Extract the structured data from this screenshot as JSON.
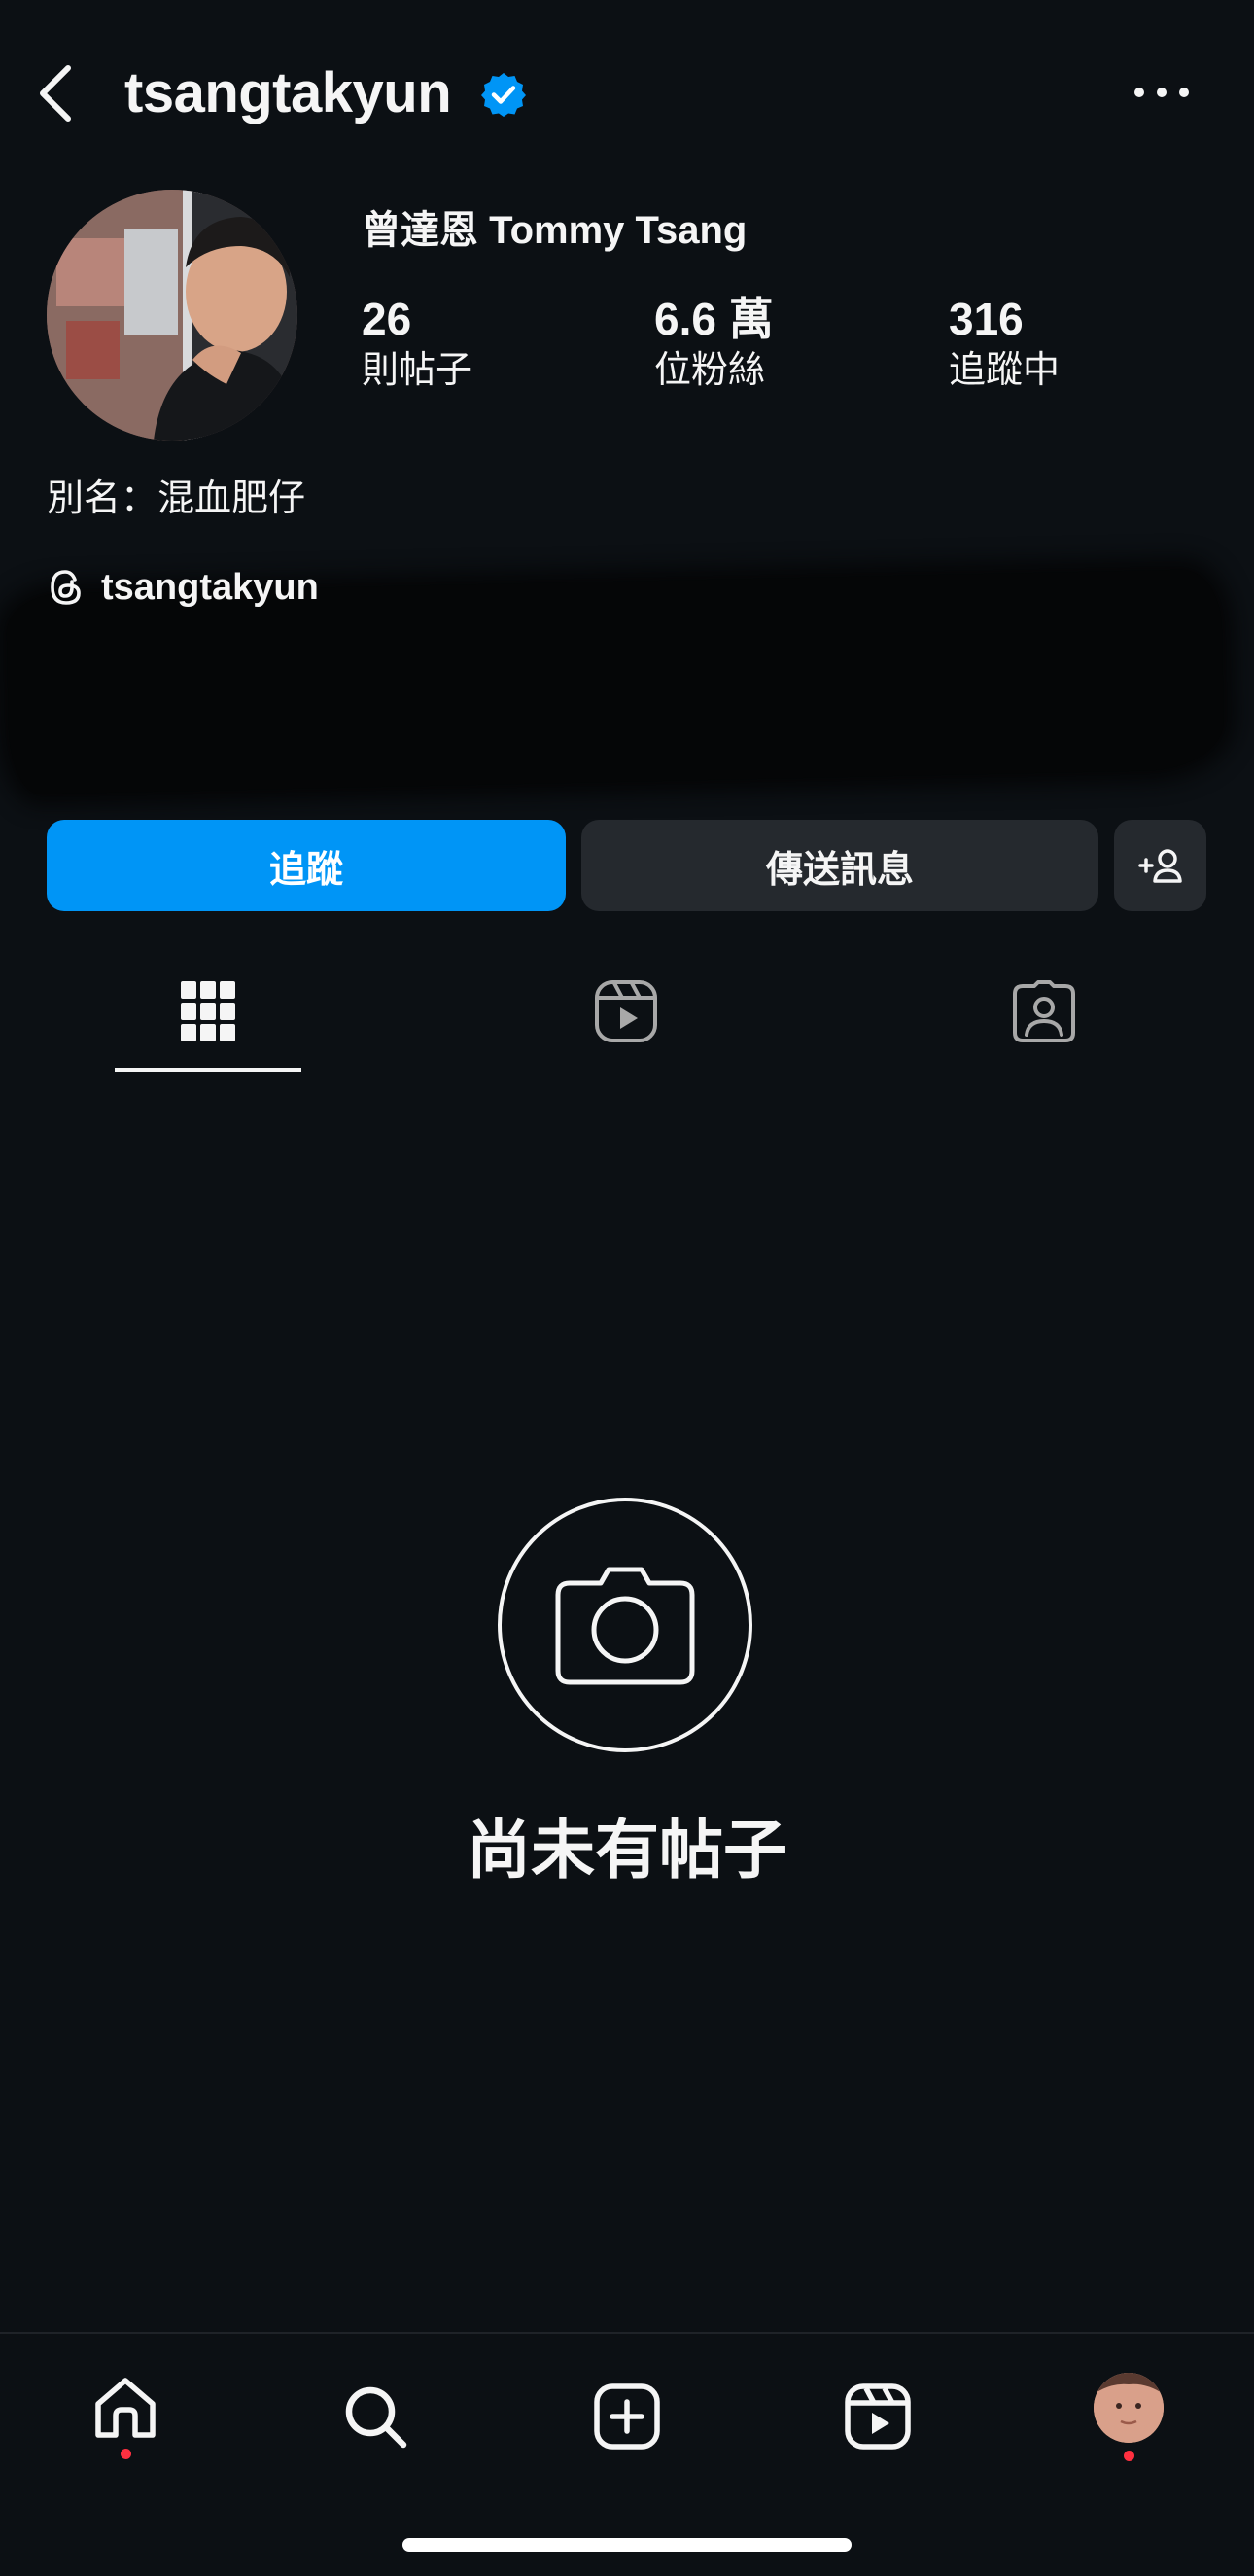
{
  "header": {
    "username": "tsangtakyun"
  },
  "profile": {
    "full_name": "曾達恩 Tommy Tsang",
    "stats": [
      {
        "value": "26",
        "label": "則帖子"
      },
      {
        "value": "6.6 萬",
        "label": "位粉絲"
      },
      {
        "value": "316",
        "label": "追蹤中"
      }
    ],
    "bio": "別名：混血肥仔",
    "threads_handle": "tsangtakyun"
  },
  "actions": {
    "follow_label": "追蹤",
    "message_label": "傳送訊息"
  },
  "tabs": [
    {
      "icon": "grid-icon",
      "active": true
    },
    {
      "icon": "reels-icon",
      "active": false
    },
    {
      "icon": "tagged-icon",
      "active": false
    }
  ],
  "empty_state": {
    "text": "尚未有帖子",
    "icon": "camera-icon"
  },
  "bottom_nav": [
    {
      "icon": "home-icon",
      "notification_dot": true
    },
    {
      "icon": "search-icon",
      "notification_dot": false
    },
    {
      "icon": "create-icon",
      "notification_dot": false
    },
    {
      "icon": "reels-icon",
      "notification_dot": false
    },
    {
      "icon": "profile-avatar",
      "notification_dot": true
    }
  ],
  "colors": {
    "background": "#0c1014",
    "accent": "#0095f6",
    "secondary_button": "#25292e",
    "verified_badge": "#0095f6",
    "notification_dot": "#ff3040"
  }
}
